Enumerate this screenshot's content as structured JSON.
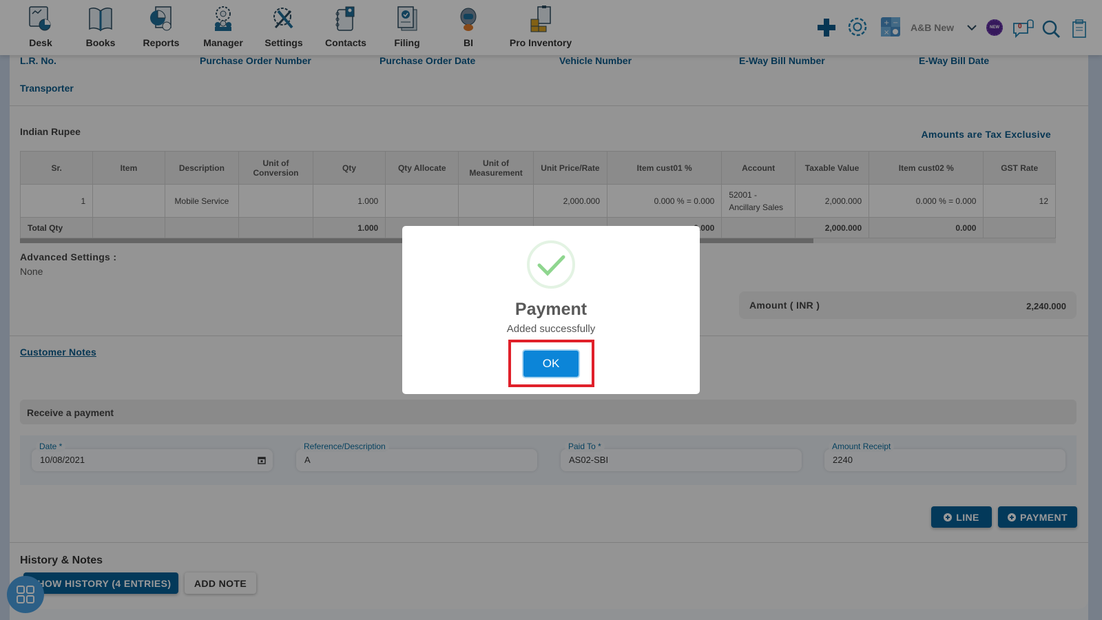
{
  "nav": {
    "items": [
      {
        "label": "Desk",
        "icon": "desk-icon"
      },
      {
        "label": "Books",
        "icon": "books-icon"
      },
      {
        "label": "Reports",
        "icon": "reports-icon"
      },
      {
        "label": "Manager",
        "icon": "manager-icon"
      },
      {
        "label": "Settings",
        "icon": "settings-icon"
      },
      {
        "label": "Contacts",
        "icon": "contacts-icon"
      },
      {
        "label": "Filing",
        "icon": "filing-icon"
      },
      {
        "label": "BI",
        "icon": "bi-robot-icon"
      },
      {
        "label": "Pro Inventory",
        "icon": "pro-inventory-icon"
      }
    ],
    "company": "A&B New",
    "new_badge": "NEW",
    "notification_count": "0"
  },
  "shipping": {
    "lr_no": "L.R. No.",
    "po_number": "Purchase Order Number",
    "po_date": "Purchase Order Date",
    "vehicle_number": "Vehicle Number",
    "eway_bill_number": "E-Way Bill Number",
    "eway_bill_date": "E-Way Bill Date",
    "transporter": "Transporter"
  },
  "items": {
    "currency": "Indian Rupee",
    "tax_mode": "Amounts are Tax Exclusive",
    "columns": [
      "Sr.",
      "Item",
      "Description",
      "Unit of Conversion",
      "Qty",
      "Qty Allocate",
      "Unit of Measurement",
      "Unit Price/Rate",
      "Item cust01 %",
      "Account",
      "Taxable Value",
      "Item cust02 %",
      "GST Rate"
    ],
    "rows": [
      [
        "1",
        "",
        "Mobile Service",
        "",
        "1.000",
        "",
        "",
        "2,000.000",
        "0.000 % = 0.000",
        "52001 - Ancillary Sales",
        "2,000.000",
        "0.000 % = 0.000",
        "12"
      ]
    ],
    "total": [
      "Total Qty",
      "",
      "",
      "",
      "1.000",
      "",
      "",
      "",
      "0.000",
      "",
      "2,000.000",
      "0.000",
      ""
    ]
  },
  "advanced": {
    "label": "Advanced Settings :",
    "value": "None"
  },
  "amount": {
    "label": "Amount ( INR )",
    "value": "2,240.000"
  },
  "customer_notes": "Customer Notes",
  "payment": {
    "heading": "Receive a payment",
    "date_label": "Date *",
    "date_value": "10/08/2021",
    "ref_label": "Reference/Description",
    "ref_value": "A",
    "paid_to_label": "Paid To *",
    "paid_to_value": "AS02-SBI",
    "amount_label": "Amount Receipt",
    "amount_value": "2240",
    "line_button": "LINE",
    "payment_button": "PAYMENT"
  },
  "history": {
    "title": "History & Notes",
    "show_history": "SHOW HISTORY (4 ENTRIES)",
    "add_note": "ADD NOTE"
  },
  "modal": {
    "title": "Payment",
    "message": "Added successfully",
    "ok": "OK"
  },
  "colors": {
    "brand": "#065f97",
    "ok_button": "#0c85d8",
    "success": "#8fd68f",
    "highlight": "#e0202a"
  }
}
